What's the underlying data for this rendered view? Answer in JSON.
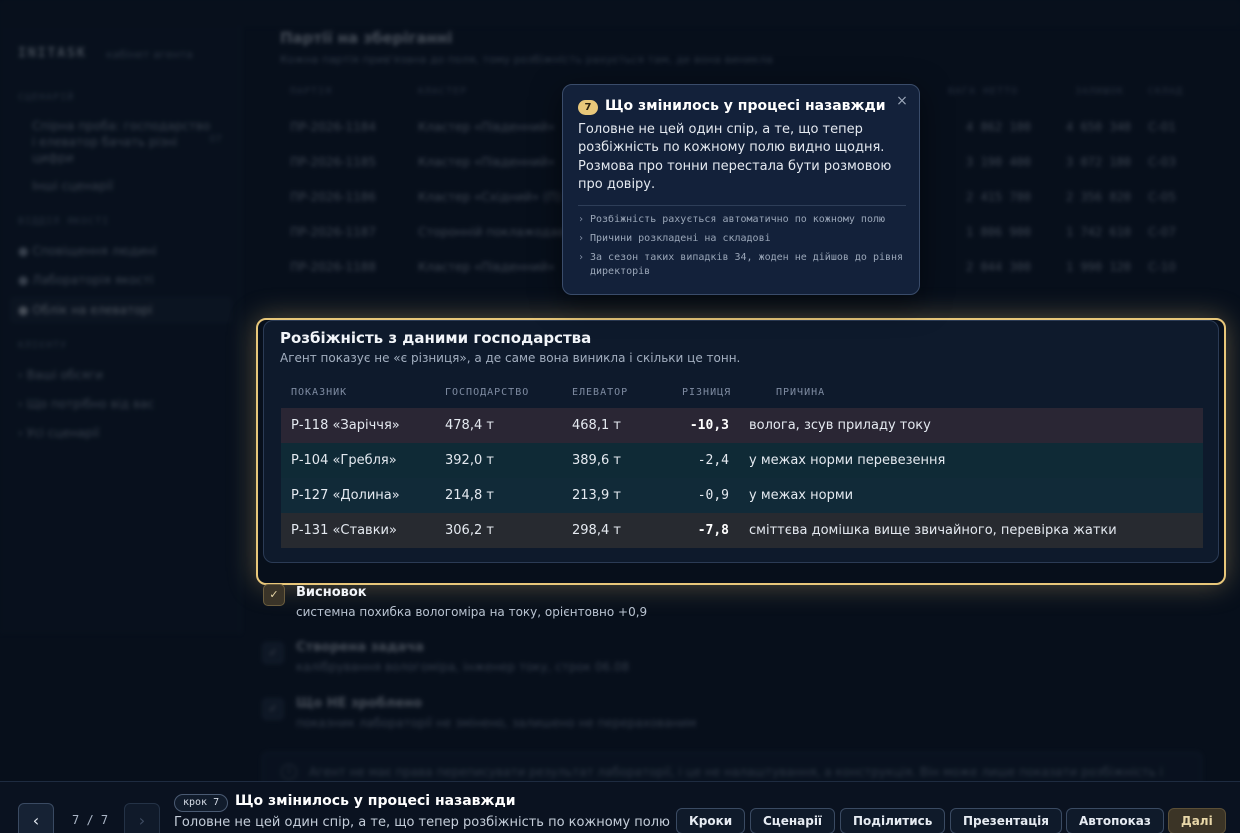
{
  "app": {
    "brand": "INITASK",
    "brand_sub": "кабінет агента"
  },
  "sidebar": {
    "section1": "СЦЕНАРІЙ",
    "scenario_item": "Спірна проба: господарство і елеватор бачать різні цифри",
    "scenario_badge": "07",
    "other_scenarios": "Інші сценарії",
    "section2": "ВІДДІЛ ЯКОСТІ",
    "items": [
      {
        "label": "Сповіщення людині"
      },
      {
        "label": "Лабораторія якості"
      },
      {
        "label": "Облік на елеваторі"
      }
    ],
    "section3": "КЛІЄНТУ",
    "client_items": [
      {
        "label": "Ваші обсяги"
      },
      {
        "label": "Що потрібно від вас"
      },
      {
        "label": "Усі сценарії"
      }
    ]
  },
  "main": {
    "title": "Партії на зберіганні",
    "subtitle": "Кожна партія прив'язана до поля, тому розбіжність рахується там, де вона виникла",
    "columns": [
      "ПАРТІЯ",
      "КЛАСТЕР",
      "ВАГА НЕТТО",
      "ЗАЛИШОК",
      "СКЛАД"
    ],
    "rows": [
      {
        "id": "ПР-2026-1184",
        "cluster": "Кластер «Південний»",
        "w1": "4 862 100",
        "w2": "4 650 340",
        "wh": "С-01"
      },
      {
        "id": "ПР-2026-1185",
        "cluster": "Кластер «Південний»",
        "w1": "3 190 400",
        "w2": "3 072 180",
        "wh": "С-03"
      },
      {
        "id": "ПР-2026-1186",
        "cluster": "Кластер «Східний» (П)",
        "w1": "2 415 780",
        "w2": "2 356 820",
        "wh": "С-05"
      },
      {
        "id": "ПР-2026-1187",
        "cluster": "Сторонній поклажодав",
        "w1": "1 806 900",
        "w2": "1 742 610",
        "wh": "С-07"
      },
      {
        "id": "ПР-2026-1188",
        "cluster": "Кластер «Південний»",
        "w1": "2 044 300",
        "w2": "1 990 120",
        "wh": "С-10"
      }
    ]
  },
  "card": {
    "title": "Розбіжність з даними господарства",
    "subtitle": "Агент показує не «є різниця», а де саме вона виникла і скільки це тонн.",
    "columns": [
      "ПОКАЗНИК",
      "ГОСПОДАРСТВО",
      "ЕЛЕВАТОР",
      "РІЗНИЦЯ",
      "ПРИЧИНА"
    ],
    "rows": [
      {
        "field": "Р-118 «Заріччя»",
        "farm": "478,4 т",
        "elev": "468,1 т",
        "diff": "-10,3",
        "reason": "волога, зсув приладу току"
      },
      {
        "field": "Р-104 «Гребля»",
        "farm": "392,0 т",
        "elev": "389,6 т",
        "diff": "-2,4",
        "reason": "у межах норми перевезення"
      },
      {
        "field": "Р-127 «Долина»",
        "farm": "214,8 т",
        "elev": "213,9 т",
        "diff": "-0,9",
        "reason": "у межах норми"
      },
      {
        "field": "Р-131 «Ставки»",
        "farm": "306,2 т",
        "elev": "298,4 т",
        "diff": "-7,8",
        "reason": "сміттєва домішка вище звичайного, перевірка жатки"
      }
    ]
  },
  "steps": {
    "conclusion_title": "Висновок",
    "conclusion_text": "системна похибка вологоміра на току, орієнтовно +0,9",
    "task_title": "Створена задача",
    "task_text": "калібрування вологоміра, інженер току, строк 06.08",
    "not_done_title": "Що НЕ зроблено",
    "not_done_text": "показник лабораторії не змінено, залишено не перерахованим",
    "note": "Агент не має права переписувати результат лабораторії, і це не налаштування, а конструкція. Він може лише показати розбіжність і"
  },
  "popover": {
    "number": "7",
    "title": "Що змінилось у процесі назавжди",
    "body": "Головне не цей один спір, а те, що тепер розбіжність по кожному полю видно щодня. Розмова про тонни перестала бути розмовою про довіру.",
    "bullets": [
      "Розбіжність рахується автоматично по кожному полю",
      "Причини розкладені на складові",
      "За сезон таких випадків 34, жоден не дійшов до рівня директорів"
    ],
    "close_glyph": "×"
  },
  "bottom": {
    "counter": "7 / 7",
    "step_pill": "крок 7",
    "title": "Що змінилось у процесі назавжди",
    "subtitle": "Головне не цей один спір, а те, що тепер розбіжність по кожному полю",
    "prev_glyph": "‹",
    "next_glyph": "›",
    "buttons": [
      "Кроки",
      "Сценарії",
      "Поділитись",
      "Презентація",
      "Автопоказ",
      "Далі"
    ]
  },
  "colors": {
    "accent": "#e8c77a",
    "background": "#0a1322"
  }
}
